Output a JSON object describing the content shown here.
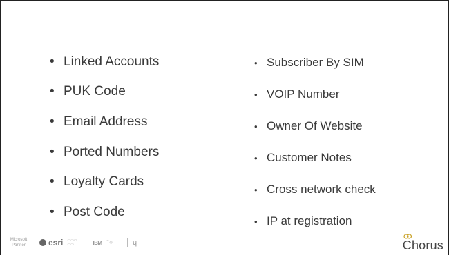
{
  "left_items": [
    "Linked Accounts",
    "PUK Code",
    "Email Address",
    "Ported Numbers",
    "Loyalty Cards",
    "Post Code"
  ],
  "right_items": [
    "Subscriber By SIM",
    "VOIP Number",
    "Owner Of Website",
    "Customer Notes",
    "Cross network check",
    "IP at registration"
  ],
  "footer": {
    "microsoft": "Microsoft Partner",
    "esri": "esri",
    "ibm": "IBM",
    "logo": "Chorus"
  },
  "colors": {
    "text": "#3a3a3a",
    "logo": "#444444",
    "ring": "#c9a227"
  }
}
